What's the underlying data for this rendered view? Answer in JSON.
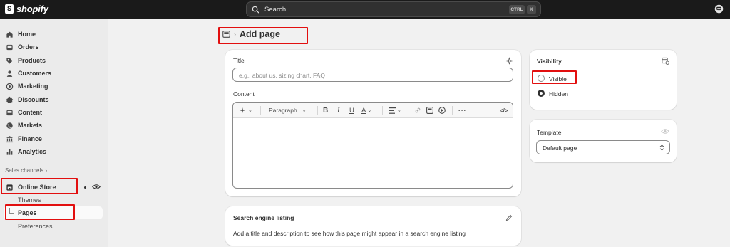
{
  "app": {
    "brand": "shopify"
  },
  "search": {
    "placeholder": "Search",
    "shortcut_ctrl": "CTRL",
    "shortcut_key": "K"
  },
  "sidebar": {
    "items": [
      {
        "label": "Home"
      },
      {
        "label": "Orders"
      },
      {
        "label": "Products"
      },
      {
        "label": "Customers"
      },
      {
        "label": "Marketing"
      },
      {
        "label": "Discounts"
      },
      {
        "label": "Content"
      },
      {
        "label": "Markets"
      },
      {
        "label": "Finance"
      },
      {
        "label": "Analytics"
      }
    ],
    "sales_channels_label": "Sales channels",
    "online_store": "Online Store",
    "sub_items": [
      {
        "label": "Themes"
      },
      {
        "label": "Pages"
      },
      {
        "label": "Preferences"
      }
    ]
  },
  "page": {
    "title": "Add page"
  },
  "title_card": {
    "title_label": "Title",
    "title_placeholder": "e.g., about us, sizing chart, FAQ",
    "content_label": "Content",
    "format_select": "Paragraph"
  },
  "seo_card": {
    "heading": "Search engine listing",
    "description": "Add a title and description to see how this page might appear in a search engine listing"
  },
  "visibility_card": {
    "heading": "Visibility",
    "options": [
      {
        "label": "Visible",
        "selected": false
      },
      {
        "label": "Hidden",
        "selected": true
      }
    ]
  },
  "template_card": {
    "heading": "Template",
    "selected": "Default page"
  },
  "colors": {
    "topbar": "#1a1a1a",
    "highlight": "#e20f0f",
    "sidebar": "#ebebeb",
    "canvas": "#f1f1f1"
  }
}
